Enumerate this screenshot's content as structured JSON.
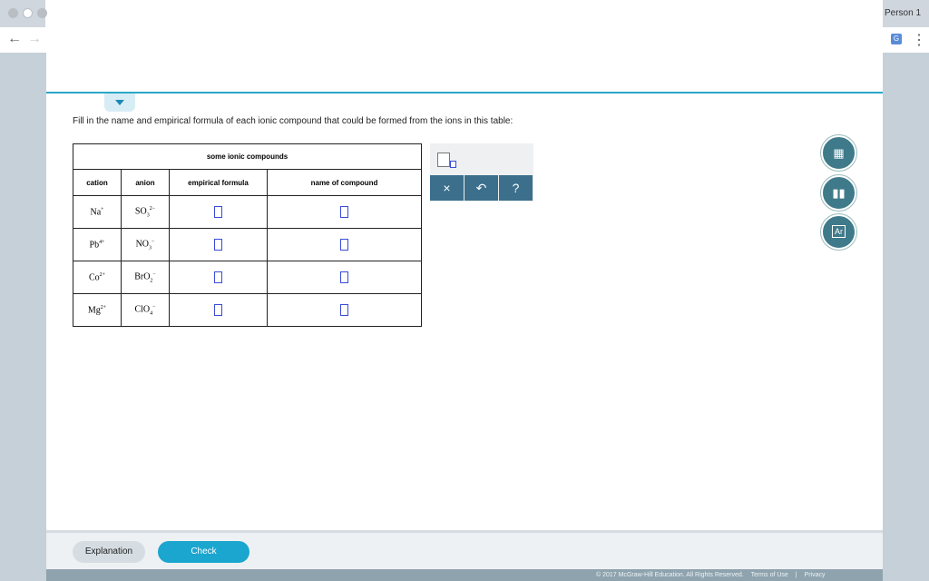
{
  "browser": {
    "profile": "Person 1",
    "back_icon": "arrow-left-icon",
    "forward_icon": "arrow-right-icon",
    "menu_icon": "kebab-menu-icon"
  },
  "question": {
    "prompt": "Fill in the name and empirical formula of each ionic compound that could be formed from the ions in this table:"
  },
  "table": {
    "caption": "some ionic compounds",
    "headers": [
      "cation",
      "anion",
      "empirical formula",
      "name of compound"
    ],
    "rows": [
      {
        "cation": "Na",
        "cation_charge": "+",
        "anion": "SO",
        "anion_sub": "3",
        "anion_charge": "2−"
      },
      {
        "cation": "Pb",
        "cation_charge": "4+",
        "anion": "NO",
        "anion_sub": "3",
        "anion_charge": "−"
      },
      {
        "cation": "Co",
        "cation_charge": "2+",
        "anion": "BrO",
        "anion_sub": "2",
        "anion_charge": "−"
      },
      {
        "cation": "Mg",
        "cation_charge": "2+",
        "anion": "ClO",
        "anion_sub": "4",
        "anion_charge": "−"
      }
    ]
  },
  "palette": {
    "clear": "×",
    "undo": "↶",
    "help": "?"
  },
  "tools": {
    "calculator_icon": "calculator-icon",
    "chart_icon": "bar-chart-icon",
    "periodic_icon": "periodic-table-icon",
    "periodic_label": "Ar"
  },
  "footer": {
    "explanation": "Explanation",
    "check": "Check",
    "copyright": "© 2017 McGraw-Hill Education. All Rights Reserved.",
    "terms": "Terms of Use",
    "separator": "|",
    "privacy": "Privacy"
  },
  "colors": {
    "accent": "#1aa6cf",
    "teal_line": "#2aa7c9",
    "palette_button": "#3b6f8c",
    "tool_button": "#3f7a8a"
  }
}
